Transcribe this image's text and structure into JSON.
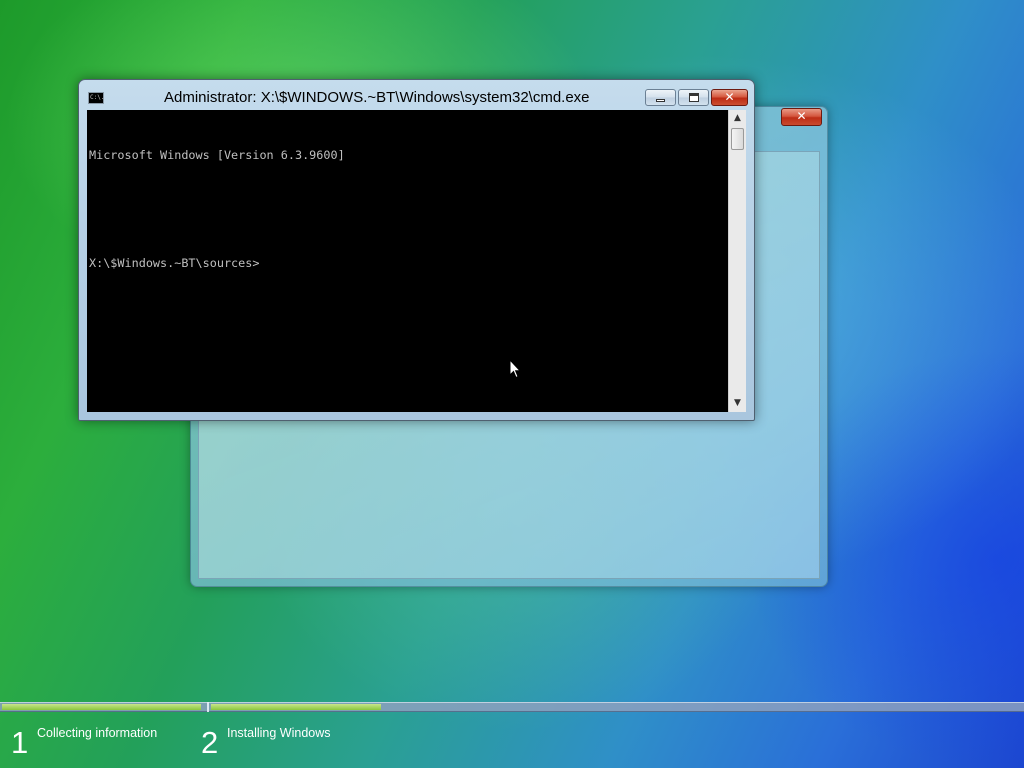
{
  "setup_window": {
    "close_glyph": "✕"
  },
  "cmd_window": {
    "icon_text": "C:\\.",
    "title": "Administrator: X:\\$WINDOWS.~BT\\Windows\\system32\\cmd.exe",
    "close_glyph": "✕",
    "console_lines": [
      "Microsoft Windows [Version 6.3.9600]",
      "",
      "X:\\$Windows.~BT\\sources>"
    ],
    "scroll_up_glyph": "▲",
    "scroll_down_glyph": "▼"
  },
  "progress": {
    "step1_fraction": 0.98,
    "step2_fraction": 0.21
  },
  "steps": [
    {
      "number": "1",
      "label": "Collecting information"
    },
    {
      "number": "2",
      "label": "Installing Windows"
    }
  ],
  "colors": {
    "progress_fill": "#8cc63e",
    "console_text": "#c0c0c0",
    "console_bg": "#000000"
  }
}
